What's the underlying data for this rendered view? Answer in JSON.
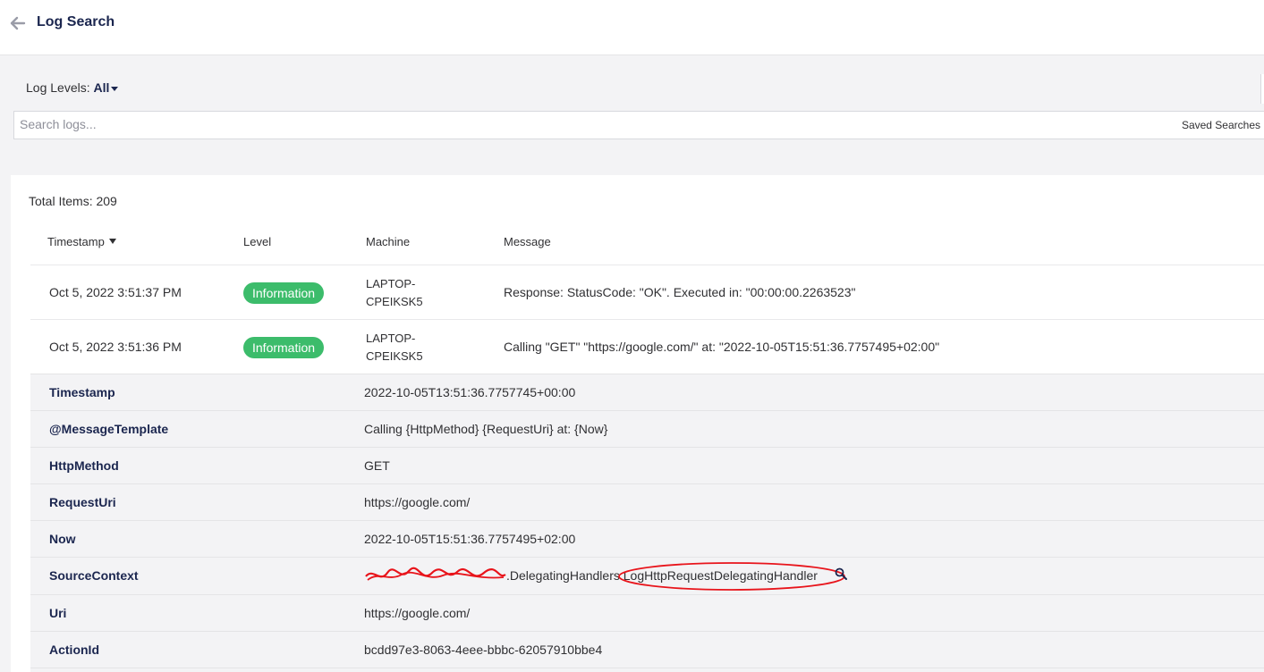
{
  "header": {
    "title": "Log Search"
  },
  "filters": {
    "log_levels_label": "Log Levels:",
    "log_levels_value": "All"
  },
  "search": {
    "placeholder": "Search logs...",
    "saved_searches": "Saved Searches"
  },
  "results": {
    "total_label": "Total Items: 209",
    "columns": [
      "Timestamp",
      "Level",
      "Machine",
      "Message"
    ],
    "rows": [
      {
        "timestamp": "Oct 5, 2022 3:51:37 PM",
        "level": "Information",
        "machine_line1": "LAPTOP-",
        "machine_line2": "CPEIKSK5",
        "message": "Response: StatusCode: \"OK\". Executed in: \"00:00:00.2263523\""
      },
      {
        "timestamp": "Oct 5, 2022 3:51:36 PM",
        "level": "Information",
        "machine_line1": "LAPTOP-",
        "machine_line2": "CPEIKSK5",
        "message": "Calling \"GET\" \"https://google.com/\" at: \"2022-10-05T15:51:36.7757495+02:00\""
      }
    ]
  },
  "details": {
    "properties": [
      {
        "key": "Timestamp",
        "value": "2022-10-05T13:51:36.7757745+00:00"
      },
      {
        "key": "@MessageTemplate",
        "value": "Calling {HttpMethod} {RequestUri} at: {Now}"
      },
      {
        "key": "HttpMethod",
        "value": "GET"
      },
      {
        "key": "RequestUri",
        "value": "https://google.com/"
      },
      {
        "key": "Now",
        "value": "2022-10-05T15:51:36.7757495+02:00"
      },
      {
        "key": "SourceContext",
        "value": ".DelegatingHandlers.LogHttpRequestDelegatingHandler"
      },
      {
        "key": "Uri",
        "value": "https://google.com/"
      },
      {
        "key": "ActionId",
        "value": "bcdd97e3-8063-4eee-bbbc-62057910bbe4"
      }
    ]
  },
  "colors": {
    "accent_text": "#1b264f",
    "badge_green": "#3cbc6b",
    "annotation_red": "#e8141b",
    "page_bg": "#f3f3f5"
  },
  "icons": {
    "back": "arrow-left-icon",
    "sort": "sort-desc-icon",
    "search_value": "magnifier-icon"
  }
}
